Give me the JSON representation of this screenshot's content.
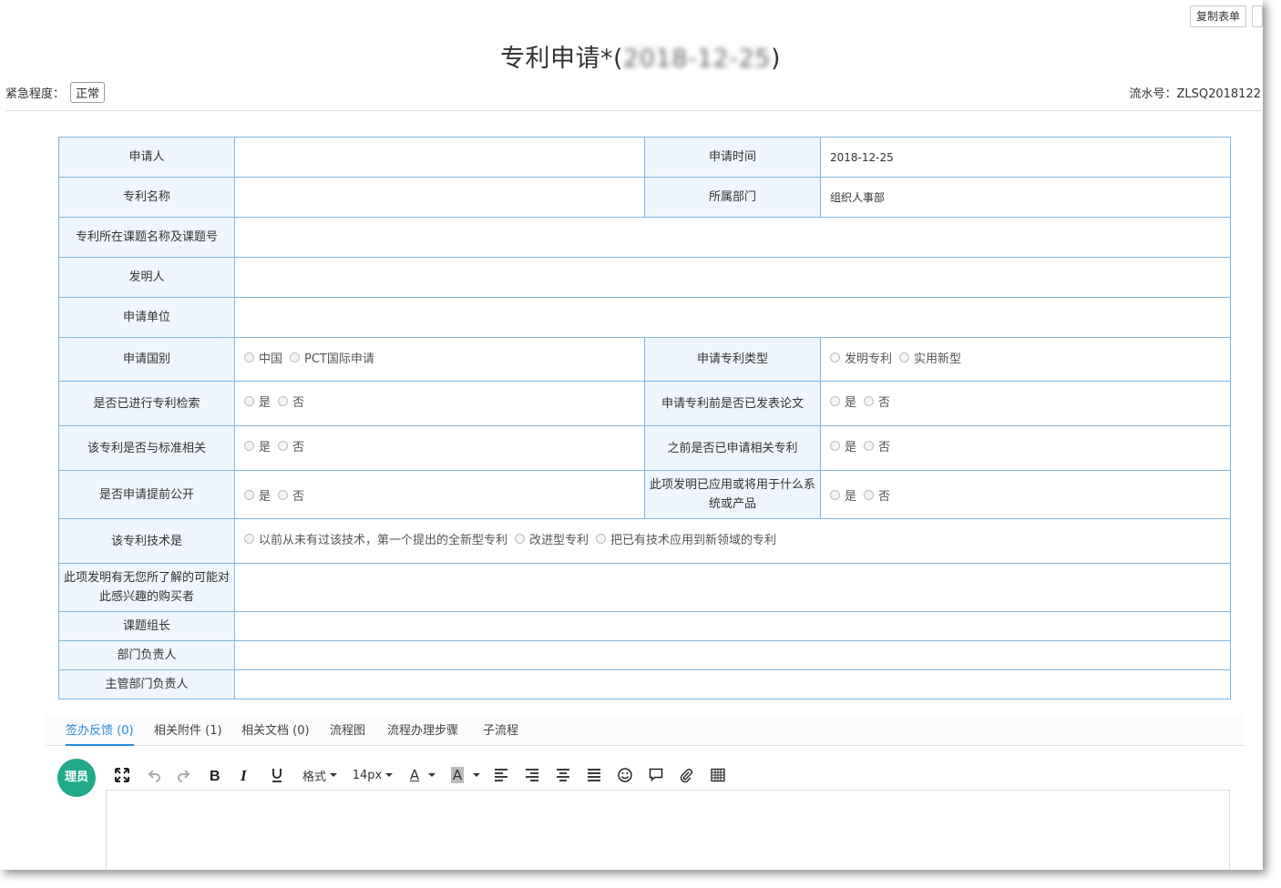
{
  "header": {
    "copy_form_label": "复制表单",
    "title_prefix": "专利申请*(",
    "title_hidden": "",
    "title_date_part": "2018-12-25",
    "title_suffix": ")",
    "urgency_label": "紧急程度：",
    "urgency_value": "正常",
    "serial_label": "流水号：ZLSQ2018122"
  },
  "form": {
    "applicant_label": "申请人",
    "applicant_value": "",
    "apply_time_label": "申请时间",
    "apply_time_value": "2018-12-25",
    "patent_name_label": "专利名称",
    "patent_name_value": "",
    "department_label": "所属部门",
    "department_value": "组织人事部",
    "project_label": "专利所在课题名称及课题号",
    "inventor_label": "发明人",
    "apply_unit_label": "申请单位",
    "country_label": "申请国别",
    "country_options": [
      "中国",
      "PCT国际申请"
    ],
    "patent_type_label": "申请专利类型",
    "patent_type_options": [
      "发明专利",
      "实用新型"
    ],
    "searched_label": "是否已进行专利检索",
    "paper_label": "申请专利前是否已发表论文",
    "standard_label": "该专利是否与标准相关",
    "related_label": "之前是否已申请相关专利",
    "early_public_label": "是否申请提前公开",
    "applied_system_label": "此项发明已应用或将用于什么系统或产品",
    "yes_label": "是",
    "no_label": "否",
    "tech_label": "该专利技术是",
    "tech_options": [
      "以前从未有过该技术，第一个提出的全新型专利",
      "改进型专利",
      "把已有技术应用到新领域的专利"
    ],
    "buyer_label": "此项发明有无您所了解的可能对此感兴趣的购买者",
    "group_leader_label": "课题组长",
    "dept_head_label": "部门负责人",
    "supervisor_label": "主管部门负责人"
  },
  "tabs": [
    {
      "label": "签办反馈 (0)"
    },
    {
      "label": "相关附件 (1)"
    },
    {
      "label": "相关文档 (0)"
    },
    {
      "label": "流程图"
    },
    {
      "label": "流程办理步骤"
    },
    {
      "label": "子流程"
    }
  ],
  "editor": {
    "avatar_text": "理员",
    "format_label": "格式",
    "font_size_label": "14px",
    "font_color_label": "A",
    "bg_color_label": "A"
  },
  "colors": {
    "border": "#7fb6e0",
    "label_bg": "#eef5fc",
    "tab_active": "#2d8cd8",
    "avatar": "#22a88b"
  }
}
